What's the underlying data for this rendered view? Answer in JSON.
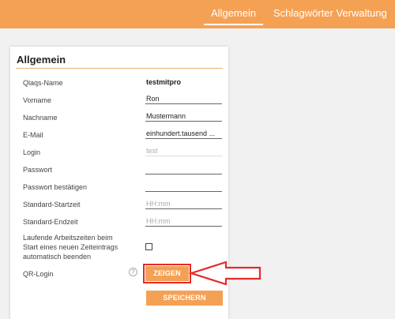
{
  "nav": {
    "active": "Allgemein",
    "items": [
      "Allgemein",
      "Schlagwörter Verwaltung"
    ]
  },
  "card": {
    "title": "Allgemein"
  },
  "form": {
    "qlaqs_name": {
      "label": "Qlaqs-Name",
      "value": "testmitpro"
    },
    "vorname": {
      "label": "Vorname",
      "value": "Ron"
    },
    "nachname": {
      "label": "Nachname",
      "value": "Mustermann"
    },
    "email": {
      "label": "E-Mail",
      "value": "einhundert.tausend ..."
    },
    "login": {
      "label": "Login",
      "value": "test"
    },
    "passwort": {
      "label": "Passwort",
      "value": ""
    },
    "passwort_bestaetigen": {
      "label": "Passwort bestätigen",
      "value": ""
    },
    "startzeit": {
      "label": "Standard-Startzeit",
      "placeholder": "HH:mm"
    },
    "endzeit": {
      "label": "Standard-Endzeit",
      "placeholder": "HH:mm"
    },
    "laufende": {
      "label_lines": [
        "Laufende Arbeitszeiten beim",
        "Start eines neuen Zeiteintrags",
        "automatisch beenden"
      ],
      "checked": false
    },
    "qr_login": {
      "label": "QR-Login",
      "help_glyph": "?",
      "button": "ZEIGEN"
    }
  },
  "save_button": "SPEICHERN",
  "colors": {
    "accent": "#f5a154",
    "highlight": "#e52b2b"
  }
}
